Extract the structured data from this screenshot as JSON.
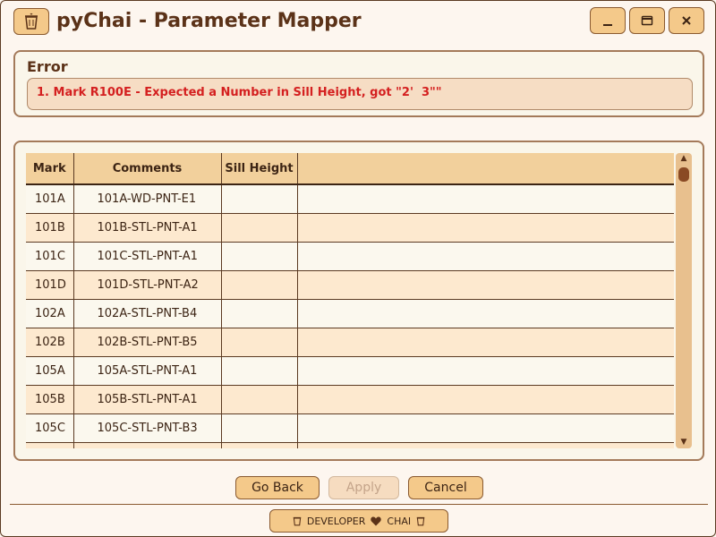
{
  "app": {
    "title": "pyChai - Parameter Mapper"
  },
  "error": {
    "title": "Error",
    "message": "1. Mark R100E - Expected a Number in Sill Height, got \"2'  3\"\""
  },
  "table": {
    "headers": [
      "Mark",
      "Comments",
      "Sill Height",
      ""
    ],
    "rows": [
      {
        "mark": "101A",
        "comments": "101A-WD-PNT-E1",
        "sill_height": ""
      },
      {
        "mark": "101B",
        "comments": "101B-STL-PNT-A1",
        "sill_height": ""
      },
      {
        "mark": "101C",
        "comments": "101C-STL-PNT-A1",
        "sill_height": ""
      },
      {
        "mark": "101D",
        "comments": "101D-STL-PNT-A2",
        "sill_height": ""
      },
      {
        "mark": "102A",
        "comments": "102A-STL-PNT-B4",
        "sill_height": ""
      },
      {
        "mark": "102B",
        "comments": "102B-STL-PNT-B5",
        "sill_height": ""
      },
      {
        "mark": "105A",
        "comments": "105A-STL-PNT-A1",
        "sill_height": ""
      },
      {
        "mark": "105B",
        "comments": "105B-STL-PNT-A1",
        "sill_height": ""
      },
      {
        "mark": "105C",
        "comments": "105C-STL-PNT-B3",
        "sill_height": ""
      },
      {
        "mark": "",
        "comments": "",
        "sill_height": ""
      }
    ]
  },
  "buttons": {
    "go_back": "Go Back",
    "apply": "Apply",
    "cancel": "Cancel"
  },
  "footer": {
    "left": "DEVELOPER",
    "right": "CHAI"
  },
  "icons": {
    "app": "chai-cup-icon",
    "minimize": "minimize-icon",
    "maximize": "maximize-icon",
    "close": "close-icon",
    "heart": "heart-icon"
  },
  "colors": {
    "accent": "#f4c98a",
    "error_text": "#d42020",
    "row_odd": "#fbf8ee",
    "row_even": "#fde9cf"
  }
}
